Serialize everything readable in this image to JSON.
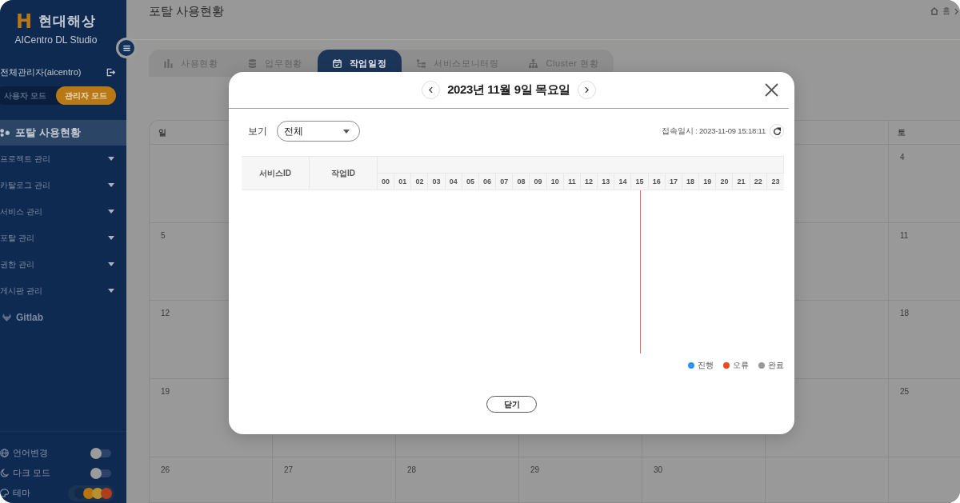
{
  "sidebar": {
    "brand": {
      "mark": "H",
      "name": "현대해상",
      "product": "AICentro DL Studio"
    },
    "user": {
      "name": "전체관리자(aicentro)"
    },
    "modes": [
      {
        "label": "사용자 모드",
        "selected": false
      },
      {
        "label": "관리자 모드",
        "selected": true
      }
    ],
    "nav": [
      {
        "kind": "section",
        "label": "포탈 사용현황",
        "selected": true
      },
      {
        "kind": "menu",
        "label": "프로젝트 관리",
        "selected": false
      },
      {
        "kind": "menu",
        "label": "카탈로그 관리",
        "selected": false
      },
      {
        "kind": "menu",
        "label": "서비스 관리",
        "selected": false
      },
      {
        "kind": "menu",
        "label": "포탈 관리",
        "selected": false
      },
      {
        "kind": "menu",
        "label": "권한 관리",
        "selected": false
      },
      {
        "kind": "menu",
        "label": "게시판 관리",
        "selected": false
      },
      {
        "kind": "link",
        "label": "Gitlab",
        "selected": false
      }
    ],
    "settings": [
      {
        "kind": "toggle",
        "label": "언어변경",
        "on": false
      },
      {
        "kind": "toggle",
        "label": "다크 모드",
        "on": false
      },
      {
        "kind": "theme",
        "label": "테마",
        "swatches": [
          {
            "color": "#13294a"
          },
          {
            "color": "#b8730f"
          },
          {
            "color": "#b4922e"
          },
          {
            "color": "#ad3f1f"
          }
        ]
      }
    ]
  },
  "header": {
    "title": "포탈 사용현황",
    "breadcrumb": [
      {
        "label": "홈"
      }
    ]
  },
  "tabs": [
    {
      "label": "사용현황",
      "selected": false
    },
    {
      "label": "업무현황",
      "selected": false
    },
    {
      "label": "작업일정",
      "selected": true
    },
    {
      "label": "서비스모니터링",
      "selected": false
    },
    {
      "label": "Cluster 현황",
      "selected": false
    }
  ],
  "calendar": {
    "weekdays": {
      "sun": "일",
      "sat": "토"
    },
    "weeks": [
      {
        "sat": "4"
      },
      {
        "sun": "5",
        "sat": "11"
      },
      {
        "sun": "12",
        "sat": "18"
      },
      {
        "sun": "19",
        "sat": "25"
      },
      {
        "sun": "26",
        "mon": "27",
        "tue": "28",
        "wed": "29",
        "thu": "30"
      }
    ]
  },
  "modal": {
    "title": "2023년 11월 9일 목요일",
    "filter": {
      "label": "보기",
      "value": "전체"
    },
    "access_time": "접속일시 : 2023-11-09 15:18:11",
    "table": {
      "columns": [
        "서비스ID",
        "작업ID"
      ],
      "hours": [
        {
          "label": "00",
          "current": false
        },
        {
          "label": "01",
          "current": false
        },
        {
          "label": "02",
          "current": false
        },
        {
          "label": "03",
          "current": false
        },
        {
          "label": "04",
          "current": false
        },
        {
          "label": "05",
          "current": false
        },
        {
          "label": "06",
          "current": false
        },
        {
          "label": "07",
          "current": false
        },
        {
          "label": "08",
          "current": false
        },
        {
          "label": "09",
          "current": false
        },
        {
          "label": "10",
          "current": false
        },
        {
          "label": "11",
          "current": false
        },
        {
          "label": "12",
          "current": false
        },
        {
          "label": "13",
          "current": false
        },
        {
          "label": "14",
          "current": false
        },
        {
          "label": "15",
          "current": true
        },
        {
          "label": "16",
          "current": false
        },
        {
          "label": "17",
          "current": false
        },
        {
          "label": "18",
          "current": false
        },
        {
          "label": "19",
          "current": false
        },
        {
          "label": "20",
          "current": false
        },
        {
          "label": "21",
          "current": false
        },
        {
          "label": "22",
          "current": false
        },
        {
          "label": "23",
          "current": false
        }
      ]
    },
    "legend": [
      {
        "label": "진행",
        "color": "#2b96f7"
      },
      {
        "label": "오류",
        "color": "#ec4a1b"
      },
      {
        "label": "완료",
        "color": "#999999"
      }
    ],
    "close_button": "닫기"
  }
}
